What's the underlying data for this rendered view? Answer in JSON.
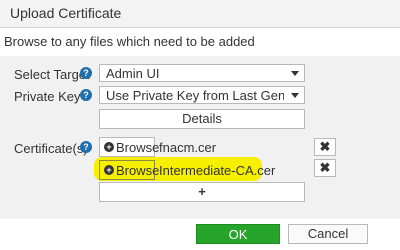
{
  "dialog": {
    "title": "Upload Certificate",
    "subtitle": "Browse to any files which need to be added"
  },
  "form": {
    "select_target": {
      "label": "Select Target",
      "value": "Admin UI"
    },
    "private_key": {
      "label": "Private Key",
      "value": "Use Private Key from Last Generated C"
    },
    "details_label": "Details",
    "certificates": {
      "label": "Certificate(s)",
      "browse_label": "Browse",
      "files": [
        "fnacm.cer",
        "Intermediate-CA.cer"
      ],
      "remove_glyph": "✖",
      "add_glyph": "+"
    }
  },
  "footer": {
    "ok_label": "OK",
    "cancel_label": "Cancel"
  },
  "colors": {
    "ok": "#26a52a",
    "highlight": "#f6f000",
    "help": "#1f6fad"
  },
  "icons": {
    "help": "question-circle-icon",
    "browse": "plus-circle-icon",
    "remove": "x-icon"
  }
}
